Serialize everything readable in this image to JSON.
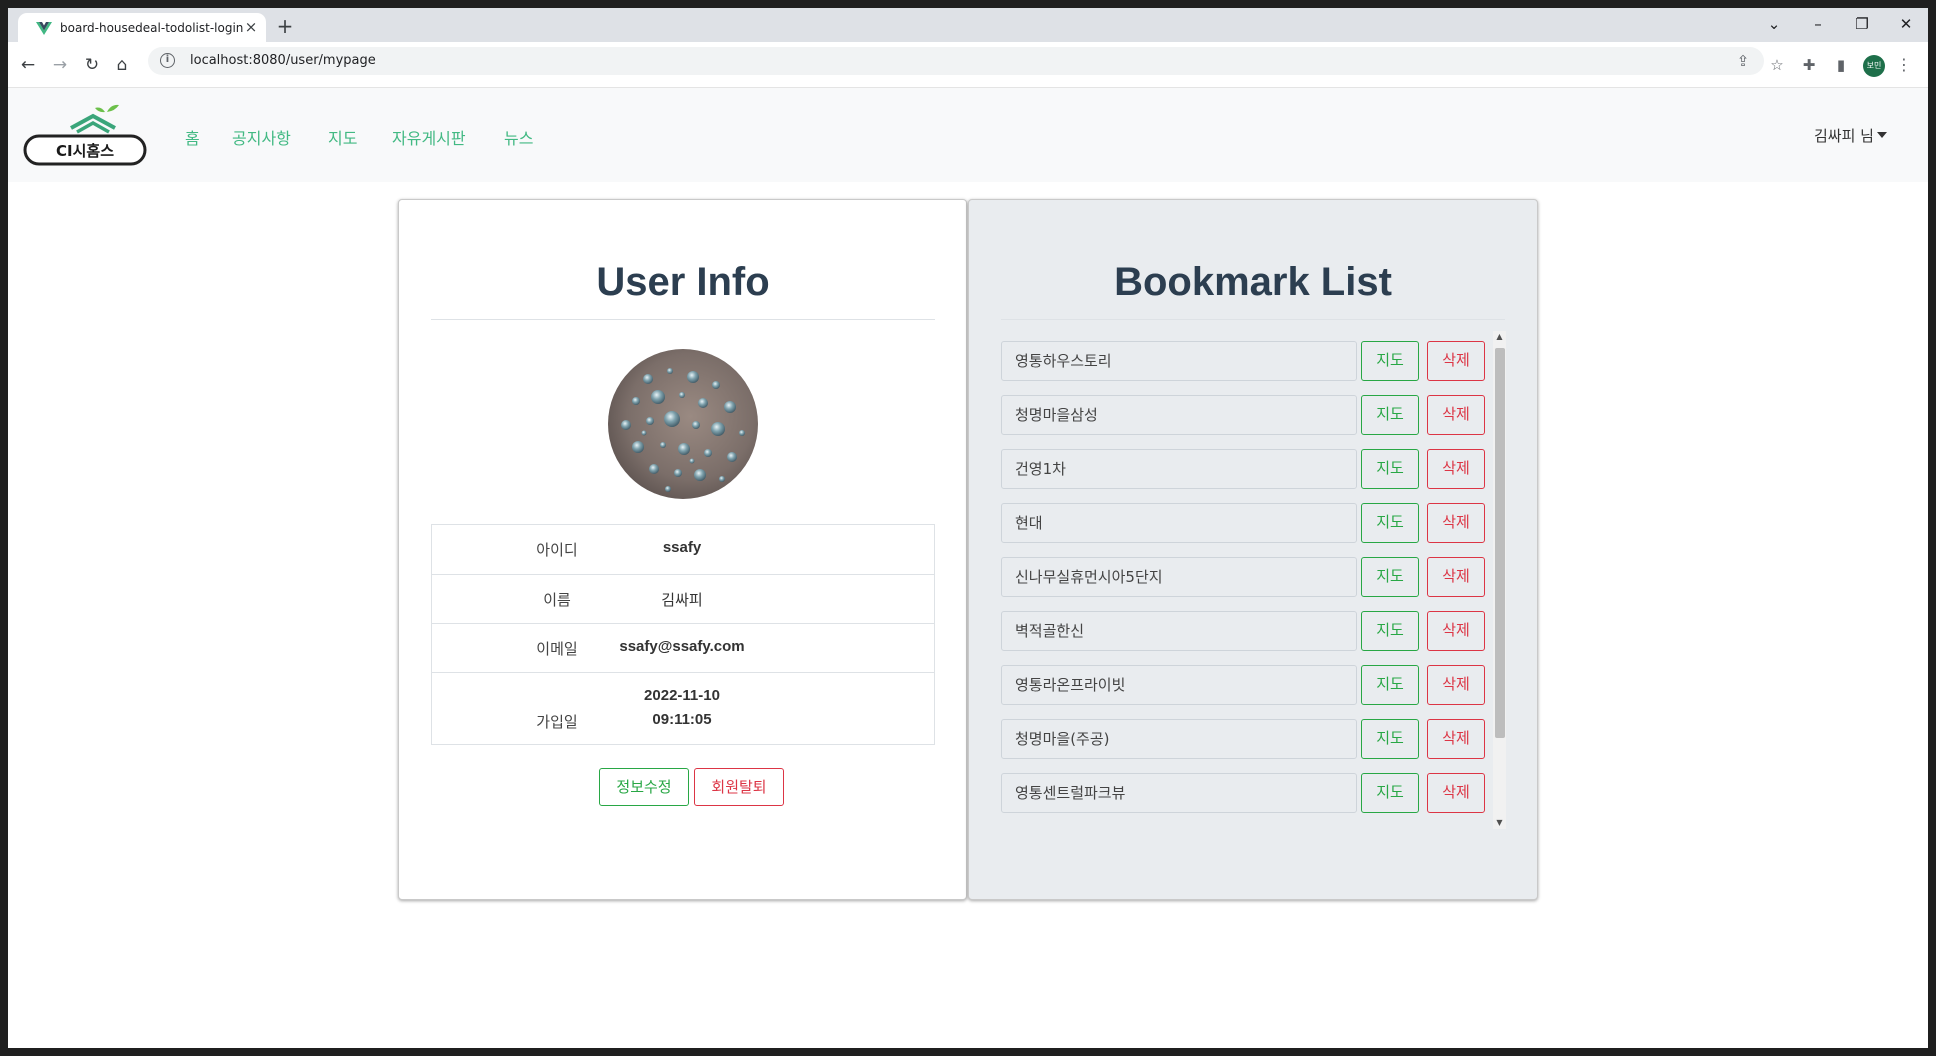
{
  "browser": {
    "tab_title": "board-housedeal-todolist-login",
    "tab_close": "×",
    "new_tab": "+",
    "url": "localhost:8080/user/mypage",
    "profile_initials": "보민",
    "win_controls": {
      "chevron": "⌄",
      "minimize": "–",
      "restore": "❐",
      "close": "✕"
    }
  },
  "nav": {
    "logo_text": "CI시홈스",
    "links": [
      "홈",
      "공지사항",
      "지도",
      "자유게시판",
      "뉴스"
    ],
    "user_label": "김싸피 님",
    "accent": "#42b983"
  },
  "user_info": {
    "title": "User Info",
    "rows": [
      {
        "label": "아이디",
        "value": "ssafy"
      },
      {
        "label": "이름",
        "value": "김싸피"
      },
      {
        "label": "이메일",
        "value": "ssafy@ssafy.com"
      },
      {
        "label": "가입일",
        "value_date": "2022-11-10",
        "value_time": "09:11:05"
      }
    ],
    "edit_button": "정보수정",
    "withdraw_button": "회원탈퇴"
  },
  "bookmarks": {
    "title": "Bookmark List",
    "map_label": "지도",
    "delete_label": "삭제",
    "items": [
      "영통하우스토리",
      "청명마을삼성",
      "건영1차",
      "현대",
      "신나무실휴먼시아5단지",
      "벽적골한신",
      "영통라온프라이빗",
      "청명마을(주공)",
      "영통센트럴파크뷰"
    ]
  },
  "colors": {
    "success": "#28a745",
    "danger": "#dc3545",
    "title": "#2c3e50"
  }
}
